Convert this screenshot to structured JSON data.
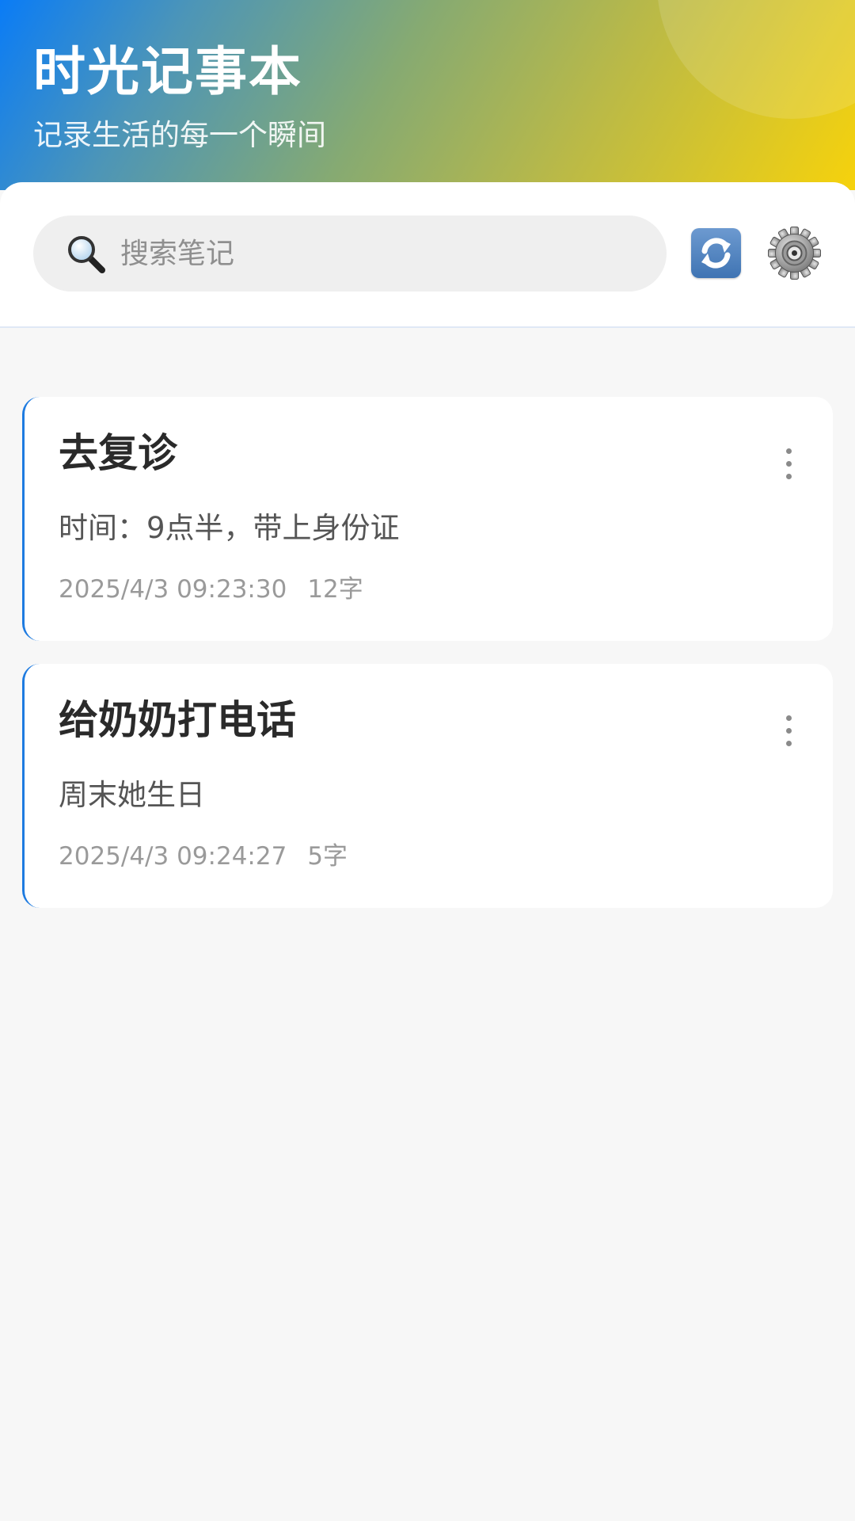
{
  "header": {
    "title": "时光记事本",
    "subtitle": "记录生活的每一个瞬间"
  },
  "toolbar": {
    "search_placeholder": "搜索笔记",
    "search_value": "",
    "icons": {
      "search": "search-icon",
      "sync": "sync-icon",
      "settings": "gear-icon"
    }
  },
  "notes": [
    {
      "title": "去复诊",
      "content": "时间：9点半，带上身份证",
      "timestamp": "2025/4/3 09:23:30",
      "word_count": "12字"
    },
    {
      "title": "给奶奶打电话",
      "content": "周末她生日",
      "timestamp": "2025/4/3 09:24:27",
      "word_count": "5字"
    }
  ],
  "colors": {
    "accent": "#1e7be0",
    "gradient_start": "#0a7cf6",
    "gradient_end": "#f6d20c"
  }
}
